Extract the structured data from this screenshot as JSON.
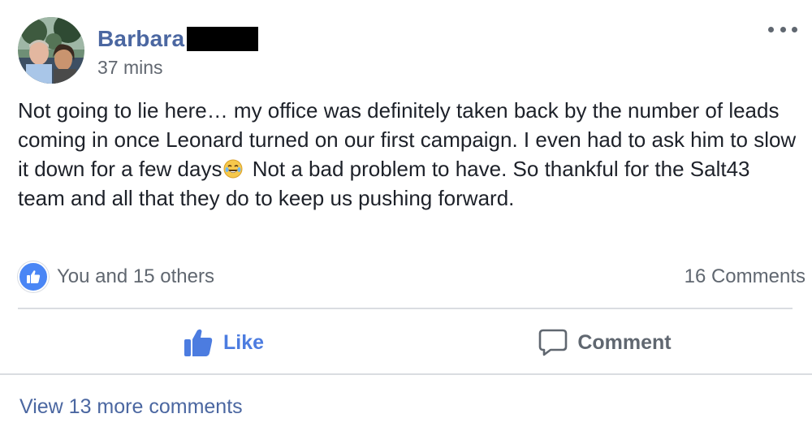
{
  "post": {
    "author": {
      "name": "Barbara",
      "name_redacted": true,
      "avatar": "couple-photo"
    },
    "timestamp": "37 mins",
    "menu_icon": "more-horizontal-icon",
    "text_before_emoji": "Not going to lie here… my office was definitely taken back by the number of leads coming in once Leonard turned on our first campaign. I even had to ask him to slow it down for a few days",
    "emoji": "laughing-tears-emoji",
    "text_after_emoji": " Not a bad problem to have. So thankful for the Salt43 team and all that they do to keep us pushing forward."
  },
  "stats": {
    "reaction_icon": "thumbs-up-icon",
    "reaction_text": "You and 15 others",
    "comment_count": "16 Comments"
  },
  "actions": {
    "like_label": "Like",
    "comment_label": "Comment"
  },
  "comments": {
    "view_more_label": "View 13 more comments"
  },
  "colors": {
    "name_link": "#4b67a1",
    "like_active": "#4c7ce0",
    "secondary_text": "#606770",
    "divider": "#dadde1"
  }
}
